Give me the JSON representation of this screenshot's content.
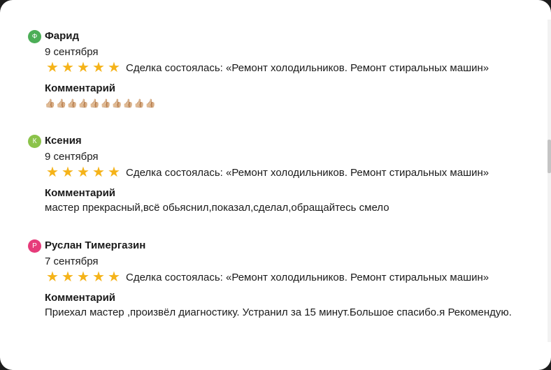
{
  "reviews": [
    {
      "initial": "Ф",
      "avatar_color": "#4cae57",
      "author": "Фарид",
      "date": "9 сентября",
      "rating": 5,
      "deal": "Сделка состоялась: «Ремонт холодильников. Ремонт стиральных машин»",
      "comment_label": "Комментарий",
      "comment": "👍🏼👍🏼👍🏼👍🏼👍🏼👍🏼👍🏼👍🏼👍🏼👍🏼"
    },
    {
      "initial": "К",
      "avatar_color": "#8bc34a",
      "author": "Ксения",
      "date": "9 сентября",
      "rating": 5,
      "deal": "Сделка состоялась: «Ремонт холодильников. Ремонт стиральных машин»",
      "comment_label": "Комментарий",
      "comment": "мастер прекрасный,всё обьяснил,показал,сделал,обращайтесь смело"
    },
    {
      "initial": "Р",
      "avatar_color": "#e63b7a",
      "author": "Руслан Тимергазин",
      "date": "7 сентября",
      "rating": 5,
      "deal": "Сделка состоялась: «Ремонт холодильников. Ремонт стиральных машин»",
      "comment_label": "Комментарий",
      "comment": "Приехал мастер ,произвёл диагностику. Устранил за 15 минут.Большое спасибо.я Рекомендую."
    }
  ],
  "colors": {
    "star": "#f5b319",
    "text": "#1a1a1a"
  },
  "icons": {
    "star": "star-icon",
    "thumbs_up": "thumbs-up-icon"
  }
}
